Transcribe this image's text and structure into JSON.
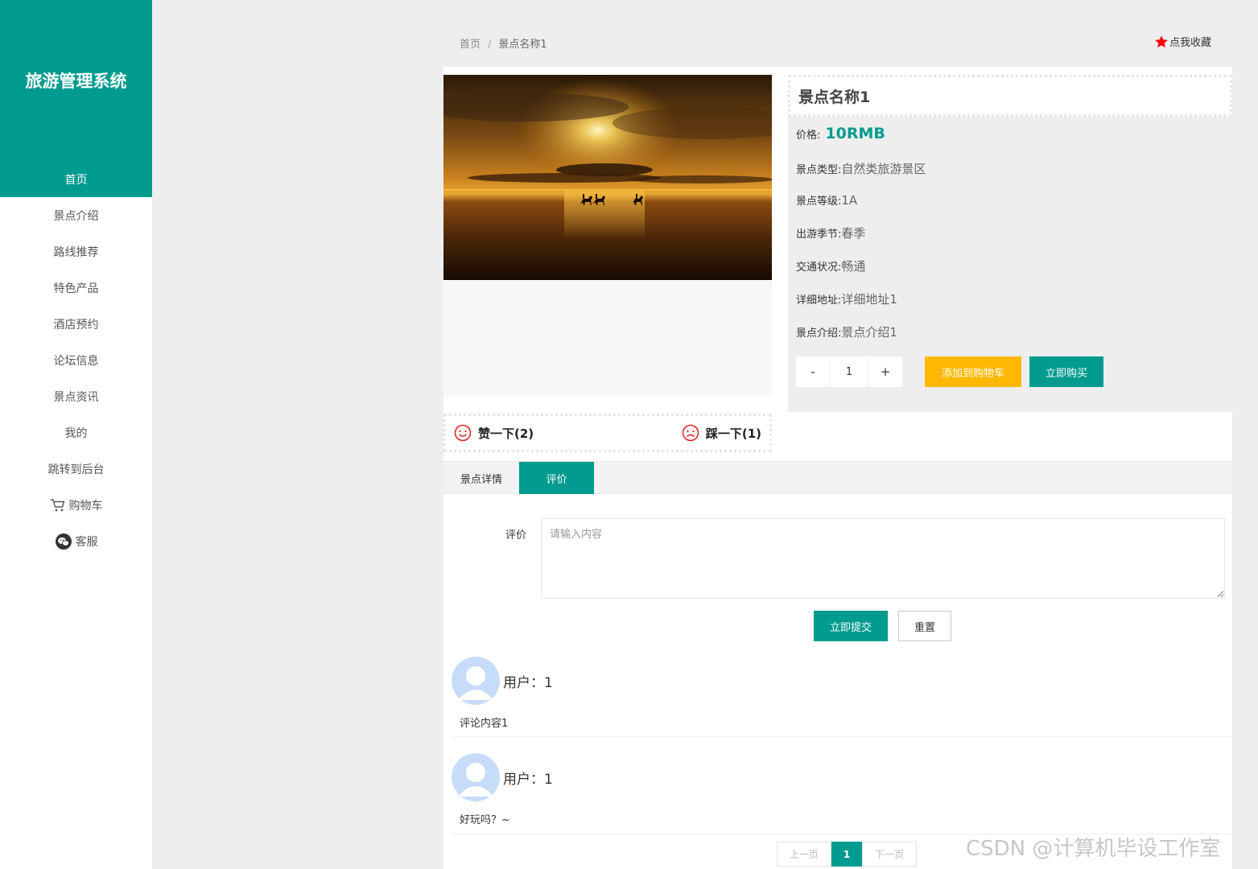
{
  "sidebar": {
    "brand": "旅游管理系统",
    "items": [
      {
        "label": "首页"
      },
      {
        "label": "景点介绍"
      },
      {
        "label": "路线推荐"
      },
      {
        "label": "特色产品"
      },
      {
        "label": "酒店预约"
      },
      {
        "label": "论坛信息"
      },
      {
        "label": "景点资讯"
      },
      {
        "label": "我的"
      },
      {
        "label": "跳转到后台"
      },
      {
        "label": "购物车",
        "icon": "cart-icon"
      },
      {
        "label": "客服",
        "icon": "wechat-icon"
      }
    ]
  },
  "breadcrumb": {
    "home": "首页",
    "separator": "/",
    "current": "景点名称1"
  },
  "favorite": {
    "label": "点我收藏",
    "icon": "star-icon",
    "icon_color": "#ff0000"
  },
  "detail": {
    "name": "景点名称1",
    "price_label": "价格:",
    "price_value": "10RMB",
    "type_label": "景点类型:",
    "type_value": "自然类旅游景区",
    "level_label": "景点等级:",
    "level_value": "1A",
    "season_label": "出游季节:",
    "season_value": "春季",
    "traffic_label": "交通状况:",
    "traffic_value": "畅通",
    "address_label": "详细地址:",
    "address_value": "详细地址1",
    "intro_label": "景点介绍:",
    "intro_value": "景点介绍1"
  },
  "quantity": {
    "minus": "-",
    "value": "1",
    "plus": "+"
  },
  "actions": {
    "add_to_cart": "添加到购物车",
    "buy_now": "立即购买"
  },
  "votes": {
    "like": "赞一下(2)",
    "dislike": "踩一下(1)"
  },
  "tabs": [
    {
      "label": "景点详情"
    },
    {
      "label": "评价",
      "active": true
    }
  ],
  "review_form": {
    "label": "评价",
    "placeholder": "请输入内容",
    "submit": "立即提交",
    "reset": "重置"
  },
  "reviews": [
    {
      "user": "用户：1",
      "content": "评论内容1"
    },
    {
      "user": "用户：1",
      "content": "好玩吗？~"
    }
  ],
  "pagination": {
    "prev": "上一页",
    "current": "1",
    "next": "下一页"
  },
  "watermark": "CSDN @计算机毕设工作室",
  "colors": {
    "primary": "#009b8f",
    "warning": "#ffb800",
    "background": "#eeeeee"
  }
}
